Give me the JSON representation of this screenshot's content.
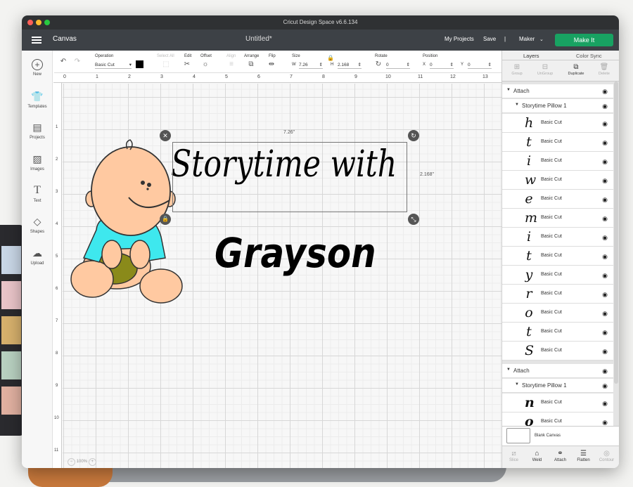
{
  "window": {
    "title": "Cricut Design Space  v6.6.134"
  },
  "header": {
    "canvas_label": "Canvas",
    "doc_title": "Untitled*",
    "my_projects": "My Projects",
    "save": "Save",
    "separator": "|",
    "machine": "Maker",
    "make_it": "Make It",
    "accent_color": "#18a262"
  },
  "toolbar": {
    "operation_label": "Operation",
    "operation_value": "Basic Cut",
    "select_all": "Select All",
    "edit": "Edit",
    "offset": "Offset",
    "align": "Align",
    "arrange": "Arrange",
    "flip": "Flip",
    "size": "Size",
    "w_label": "W",
    "w_value": "7.26",
    "h_label": "H",
    "h_value": "2.168",
    "rotate": "Rotate",
    "rotate_value": "0",
    "position": "Position",
    "x_label": "X",
    "x_value": "0",
    "y_label": "Y",
    "y_value": "0"
  },
  "leftbar": [
    {
      "label": "New",
      "icon": "plus-circle-icon"
    },
    {
      "label": "Templates",
      "icon": "shirt-icon"
    },
    {
      "label": "Projects",
      "icon": "projects-icon"
    },
    {
      "label": "Images",
      "icon": "image-icon"
    },
    {
      "label": "Text",
      "icon": "text-icon"
    },
    {
      "label": "Shapes",
      "icon": "shapes-icon"
    },
    {
      "label": "Upload",
      "icon": "upload-icon"
    }
  ],
  "rulers": {
    "top": [
      "0",
      "1",
      "2",
      "3",
      "4",
      "5",
      "6",
      "7",
      "8",
      "9",
      "10",
      "11",
      "12",
      "13"
    ],
    "left": [
      "1",
      "2",
      "3",
      "4",
      "5",
      "6",
      "7",
      "8",
      "9",
      "10",
      "11"
    ]
  },
  "canvas": {
    "line1": "Storytime with",
    "line2": "Grayson",
    "width_label": "7.26\"",
    "height_label": "2.168\"",
    "zoom": "100%"
  },
  "panel": {
    "tab_layers": "Layers",
    "tab_color_sync": "Color Sync",
    "actions": {
      "group": "Group",
      "ungroup": "UnGroup",
      "duplicate": "Duplicate",
      "delete": "Delete"
    },
    "group1": {
      "attach": "Attach",
      "name": "Storytime Pillow 1"
    },
    "layers": [
      {
        "glyph": "h",
        "label": "Basic Cut"
      },
      {
        "glyph": "t",
        "label": "Basic Cut"
      },
      {
        "glyph": "i",
        "label": "Basic Cut"
      },
      {
        "glyph": "w",
        "label": "Basic Cut"
      },
      {
        "glyph": "e",
        "label": "Basic Cut"
      },
      {
        "glyph": "m",
        "label": "Basic Cut"
      },
      {
        "glyph": "i",
        "label": "Basic Cut"
      },
      {
        "glyph": "t",
        "label": "Basic Cut"
      },
      {
        "glyph": "y",
        "label": "Basic Cut"
      },
      {
        "glyph": "r",
        "label": "Basic Cut"
      },
      {
        "glyph": "o",
        "label": "Basic Cut"
      },
      {
        "glyph": "t",
        "label": "Basic Cut"
      },
      {
        "glyph": "S",
        "label": "Basic Cut"
      }
    ],
    "group2": {
      "attach": "Attach",
      "name": "Storytime Pillow 1"
    },
    "layers2": [
      {
        "glyph": "n",
        "label": "Basic Cut"
      },
      {
        "glyph": "o",
        "label": "Basic Cut"
      }
    ],
    "blank_canvas": "Blank Canvas",
    "bottom": {
      "slice": "Slice",
      "weld": "Weld",
      "attach": "Attach",
      "flatten": "Flatten",
      "contour": "Contour"
    }
  }
}
